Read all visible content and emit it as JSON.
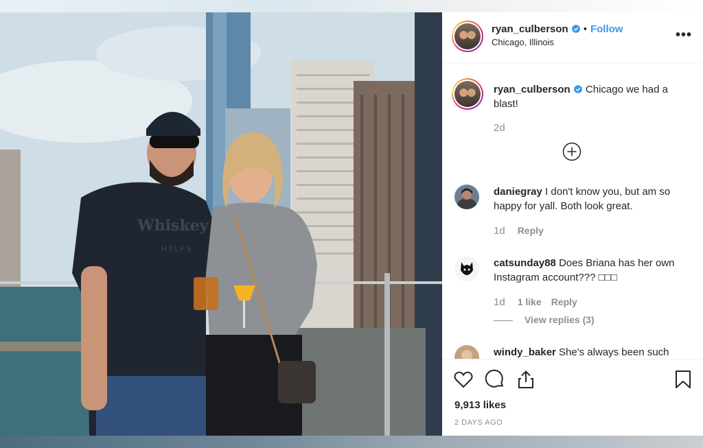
{
  "post": {
    "author": "ryan_culberson",
    "follow_label": "Follow",
    "location": "Chicago, Illinois",
    "more_label": "•••"
  },
  "caption": {
    "username": "ryan_culberson",
    "text": "Chicago we had a blast!",
    "time": "2d"
  },
  "comments": [
    {
      "username": "daniegray",
      "text": "I don't know you, but am so happy for yall. Both look great.",
      "time": "1d",
      "reply_label": "Reply"
    },
    {
      "username": "catsunday88",
      "text": "Does Briana has her own Instagram account??? □□□",
      "time": "1d",
      "likes_label": "1 like",
      "reply_label": "Reply",
      "view_replies": "View replies (3)"
    },
    {
      "username": "windy_baker",
      "text": "She's always been such"
    }
  ],
  "footer": {
    "likes": "9,913 likes",
    "date": "2 DAYS AGO"
  },
  "photo": {
    "shirt_text": "Whiskey",
    "shirt_subtext": "HELPS"
  },
  "colors": {
    "accent": "#3897f0",
    "muted": "#8e8e8e",
    "text": "#262626"
  },
  "icons": [
    "heart-icon",
    "comment-icon",
    "share-icon",
    "bookmark-icon",
    "verified-icon",
    "plus-circle-icon",
    "more-icon"
  ]
}
